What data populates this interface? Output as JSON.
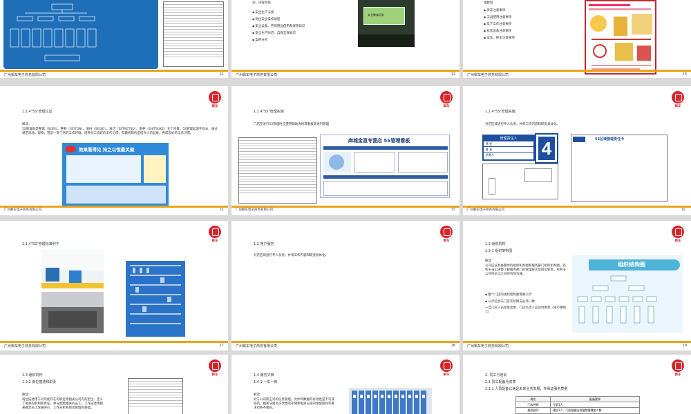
{
  "company": "广州枫车电子商务有限公司",
  "logo_text": "枫车",
  "slides": {
    "s11": {
      "page": "11",
      "text1": "的制度，内容包含安全管理人员的职责、基本职能、门店管理人员对各项相关和规定行示",
      "text2": "门店根本消防设备应在专人负责管理，并记录在案，定期更换保养。"
    },
    "s12": {
      "page": "12",
      "intro": "训，内容包括",
      "bullets": [
        "安全生产法规",
        "岗位安全操作规程",
        "安全设备、劳保用品使用和保管知识",
        "安全生产防范、自救互救知识",
        "案例分析"
      ],
      "photo_caption": "安全教育培训"
    },
    "s13": {
      "page": "13",
      "intro": "理教程",
      "bullets": [
        "停车注意事项",
        "工具使用注意事项",
        "车下工作注意事项",
        "拆装设备注意事项",
        "试车、移车注意事项"
      ]
    },
    "s14": {
      "page": "14",
      "title": "1.1.4\"5S\"管理认证",
      "label": "解读：",
      "text": "5S管理就是整理（SEIRI）、整顿（SEITON）、清扫（SEISO）、清洁（SETKETSU）、素养（SHITSUKE）五个项目。5S管理起源于日本，通过规范现场、现物，营造一目了然的工作环境，培养员工良好的工作习惯，其最终目的是提升人的品质，养成良好的工作习惯。",
      "banner": "效果看得见 持之以恒最关键"
    },
    "s15": {
      "page": "15",
      "title": "1.1.4\"5S\"管理实施",
      "text": "门店在进行5S管理时应使用辅助表格或看板等进行管理",
      "board_title": "麻城金直专营店 5S管理看板"
    },
    "s16": {
      "page": "16",
      "title": "1.1.4\"5S\"管理实施",
      "text": "对店区域进行专人负责，并将工作内容和职责具体化。",
      "card_title": "管理责任人",
      "card_rows": [
        "责 任",
        "姓 名",
        "负责人"
      ],
      "big_number": "4",
      "table_title": "5S区域管理责任卡"
    },
    "s17": {
      "page": "17",
      "title": "1.1.4\"5S\"管理标准例子"
    },
    "s18": {
      "page": "18",
      "title": "1.2 用户服务",
      "text": "对店区域进行专人负责，并将工作内容和职责具体化。"
    },
    "s19": {
      "page": "19",
      "title": "1.3 组织机构",
      "subtitle": "1.3.1 组织架构图",
      "label": "解读：",
      "text": "公司应该具备整体的组织机构图和服务部门组织机构图，有利于员工清楚了解服务部门的管理层次及岗位职责，有利于公司内员工之间的有效沟通。",
      "bullets": [
        "整个门店的组织结构图需要公示",
        "公示信息与门店实际情况必须一致",
        "一旦门店人员发生变更，门店负责人应及时更新（或不相吻上）"
      ],
      "chart_title": "组织结构图"
    },
    "s20": {
      "page": "20",
      "title": "1.3 组织机构",
      "subtitle": "1.3.2 岗位描述和职责",
      "label": "解读：",
      "text": "岗位描述用于对可能存在的职位等相关公司内的定位、定义了相关的权利和责任，并分配给相关的员工。工作描述用把来确定员工发展评价、工作分析和职位管理的基础。"
    },
    "s21": {
      "page": "21",
      "title": "1.4 服务文档",
      "subtitle": "1.4.1 一车一档",
      "label": "解读：",
      "text": "对于公司所正常的信息管理，文件和数据的有效性是不可或缺的，相关法规对于文档的存储和相关记录的保留期间等要求也各不相同。"
    },
    "s22": {
      "page": "22",
      "title": "2. 员工与培训",
      "subtitle": "2.1 员工配备与资质",
      "subtitle2": "2.1.1 人员配备以满足未来业务发展，并保证服务质量",
      "table_headers": [
        "岗位",
        "配备要求"
      ],
      "table_rows": [
        [
          "门店经理",
          "专职1人"
        ],
        [
          "服务顾问",
          "建议1人，门店根据业务量酌情增加人数"
        ]
      ]
    }
  }
}
